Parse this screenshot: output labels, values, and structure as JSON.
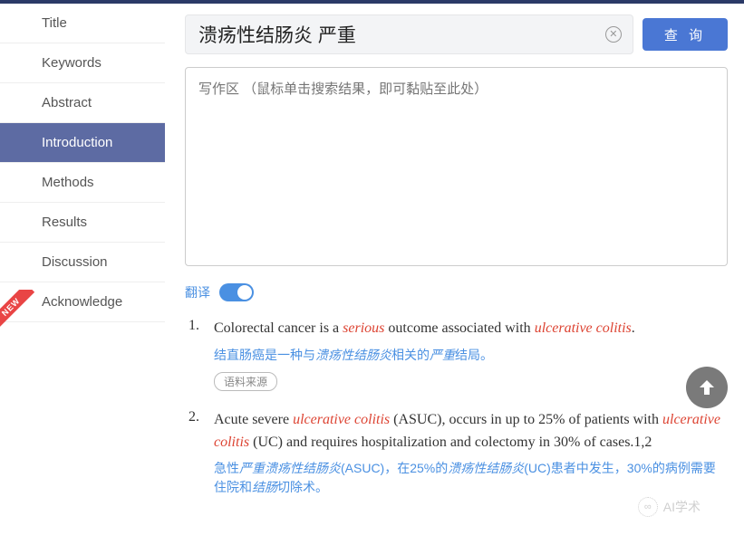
{
  "sidebar": {
    "items": [
      {
        "label": "Title"
      },
      {
        "label": "Keywords"
      },
      {
        "label": "Abstract"
      },
      {
        "label": "Introduction"
      },
      {
        "label": "Methods"
      },
      {
        "label": "Results"
      },
      {
        "label": "Discussion"
      },
      {
        "label": "Acknowledge"
      }
    ],
    "active_index": 3,
    "new_badge": "NEW"
  },
  "search": {
    "value": "溃疡性结肠炎 严重",
    "clear_glyph": "✕",
    "query_label": "查 询"
  },
  "write_area": {
    "placeholder": "写作区 （鼠标单击搜索结果，即可黏贴至此处）"
  },
  "translate": {
    "label": "翻译",
    "on": true
  },
  "results": [
    {
      "num": "1.",
      "en_parts": [
        {
          "t": "Colorectal cancer is a ",
          "hl": false
        },
        {
          "t": "serious",
          "hl": true
        },
        {
          "t": " outcome associated with ",
          "hl": false
        },
        {
          "t": "ulcerative colitis",
          "hl": true
        },
        {
          "t": ".",
          "hl": false
        }
      ],
      "zh_parts": [
        {
          "t": "结直肠癌是一种与",
          "hl": false
        },
        {
          "t": "溃疡性结肠炎",
          "hl": true
        },
        {
          "t": "相关的",
          "hl": false
        },
        {
          "t": "严重",
          "hl": true
        },
        {
          "t": "结局。",
          "hl": false
        }
      ],
      "source_label": "语料来源"
    },
    {
      "num": "2.",
      "en_parts": [
        {
          "t": "Acute severe ",
          "hl": false
        },
        {
          "t": "ulcerative colitis",
          "hl": true
        },
        {
          "t": " (ASUC), occurs in up to 25% of patients with ",
          "hl": false
        },
        {
          "t": "ulcerative colitis",
          "hl": true
        },
        {
          "t": " (UC) and requires hospitalization and colectomy in 30% of cases.1,2",
          "hl": false
        }
      ],
      "zh_parts": [
        {
          "t": "急性",
          "hl": false
        },
        {
          "t": "严重溃疡性结肠炎",
          "hl": true
        },
        {
          "t": "(ASUC)，在25%的",
          "hl": false
        },
        {
          "t": "溃疡性结肠炎",
          "hl": true
        },
        {
          "t": "(UC)患者中发生，30%的病例需要住院和",
          "hl": false
        },
        {
          "t": "结肠",
          "hl": true
        },
        {
          "t": "切除术。",
          "hl": false
        }
      ]
    }
  ],
  "watermark": {
    "text": "AI学术"
  }
}
